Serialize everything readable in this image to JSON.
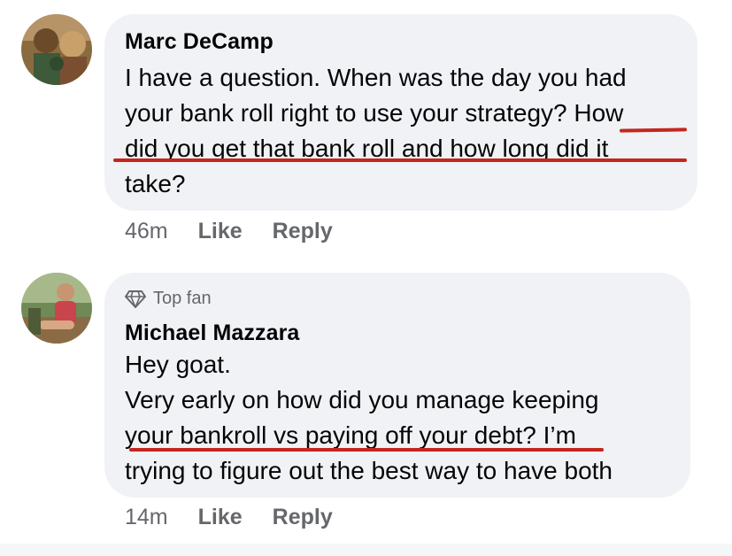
{
  "comments": [
    {
      "author": "Marc DeCamp",
      "badge": "",
      "lines": [
        "I have a question. When was the day you had",
        "your bank roll right to use your strategy? How",
        "did you get that bank roll and how long did it",
        "take?"
      ],
      "time": "46m",
      "like_label": "Like",
      "reply_label": "Reply"
    },
    {
      "author": "Michael Mazzara",
      "badge": "Top fan",
      "lines": [
        "Hey goat.",
        "Very early on how did you manage keeping",
        "your bankroll vs paying off your debt? I’m",
        "trying to figure out the best way to have both"
      ],
      "time": "14m",
      "like_label": "Like",
      "reply_label": "Reply"
    }
  ],
  "icons": {
    "badge_icon": "diamond-icon"
  },
  "colors": {
    "bubble": "#f0f2f5",
    "secondary_text": "#65676b",
    "underline_mark": "#c4261f"
  }
}
